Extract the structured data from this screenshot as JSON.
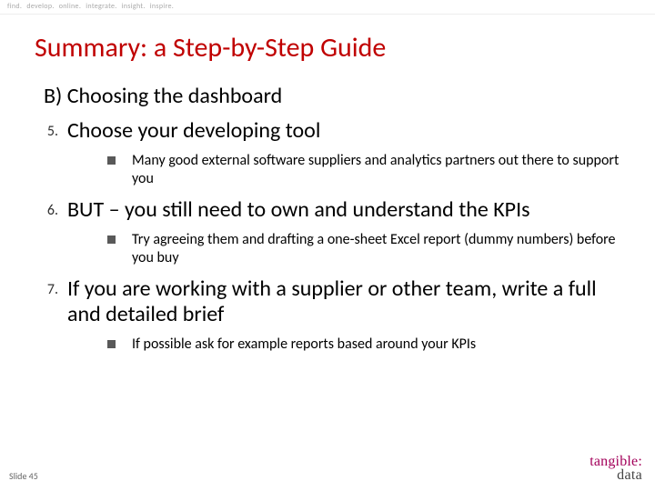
{
  "topbar": {
    "words": [
      "find.",
      "develop.",
      "online.",
      "integrate.",
      "insight.",
      "inspire."
    ]
  },
  "title": "Summary: a Step-by-Step Guide",
  "section": "B) Choosing the dashboard",
  "items": [
    {
      "num": "5.",
      "head": "Choose your developing tool",
      "subs": [
        "Many good external software suppliers and analytics partners out there to support you"
      ]
    },
    {
      "num": "6.",
      "head": "BUT – you still need to own and understand the KPIs",
      "subs": [
        "Try agreeing them and drafting a one-sheet Excel report (dummy numbers) before you buy"
      ]
    },
    {
      "num": "7.",
      "head": "If you are working with a supplier or other team, write a full and detailed brief",
      "subs": [
        "If possible ask for example reports based around your KPIs"
      ]
    }
  ],
  "footer": "Slide 45",
  "logo": {
    "line1": "tangible:",
    "line2": "data"
  }
}
